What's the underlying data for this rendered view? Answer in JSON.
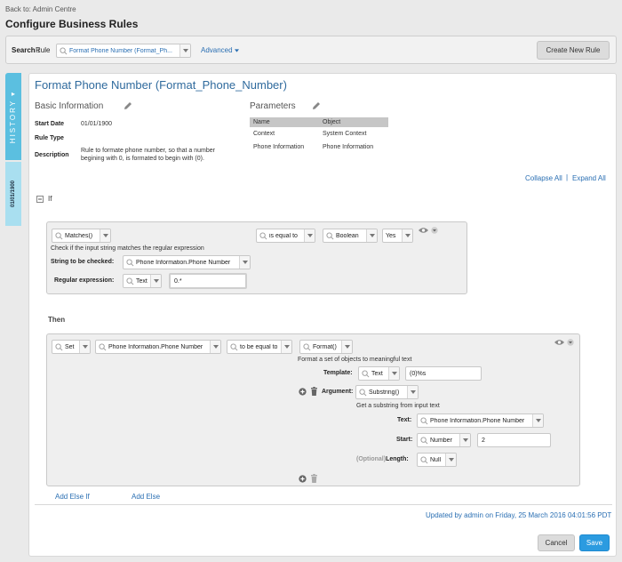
{
  "header": {
    "back_link": "Back to: Admin Centre",
    "page_title": "Configure Business Rules"
  },
  "search": {
    "label": "Search :",
    "type_label": "Rule",
    "value": "Format Phone Number (Format_Ph...",
    "advanced_label": "Advanced",
    "create_button": "Create New Rule"
  },
  "side_tabs": {
    "history_label": "HISTORY",
    "date_label": "01/01/1900"
  },
  "rule": {
    "title": "Format Phone Number (Format_Phone_Number)",
    "basic_info_title": "Basic Information",
    "start_date_label": "Start Date",
    "start_date": "01/01/1900",
    "rule_type_label": "Rule Type",
    "description_label": "Description",
    "description_line1": "Rule to formate phone number, so that a number",
    "description_line2": "begining with 0, is formated to begin with (0).",
    "parameters_title": "Parameters",
    "params_headers": [
      "Name",
      "Object"
    ],
    "params_rows": [
      [
        "Context",
        "System Context"
      ],
      [
        "Phone Information",
        "Phone Information"
      ]
    ]
  },
  "controls": {
    "collapse_all": "Collapse All",
    "separator": "|",
    "expand_all": "Expand All",
    "if_label": "If",
    "then_label": "Then",
    "add_else_if": "Add Else If",
    "add_else": "Add Else"
  },
  "if_block": {
    "function": "Matches()",
    "operator": "is equal to",
    "type": "Boolean",
    "value": "Yes",
    "description": "Check if the input string matches the regular expression",
    "string_label": "String to be checked:",
    "string_value": "Phone Information.Phone Number",
    "regex_label": "Regular expression:",
    "regex_type": "Text",
    "regex_value": "0.*"
  },
  "then_block": {
    "action": "Set",
    "target": "Phone Information.Phone Number",
    "operator": "to be equal to",
    "function": "Format()",
    "function_desc": "Format a set of objects to meaningful text",
    "template_label": "Template:",
    "template_type": "Text",
    "template_value": "(0)%s",
    "argument_label": "Argument:",
    "argument_func": "Substring()",
    "substring_desc": "Get a substring from input text",
    "text_label": "Text:",
    "text_value": "Phone Information.Phone Number",
    "start_label": "Start:",
    "start_type": "Number",
    "start_value": "2",
    "optional_label": "(Optional)",
    "length_label": "Length:",
    "length_type": "Null"
  },
  "footer": {
    "updated_by": "Updated by admin on Friday, 25 March 2016 04:01:56 PDT",
    "cancel": "Cancel",
    "save": "Save"
  }
}
